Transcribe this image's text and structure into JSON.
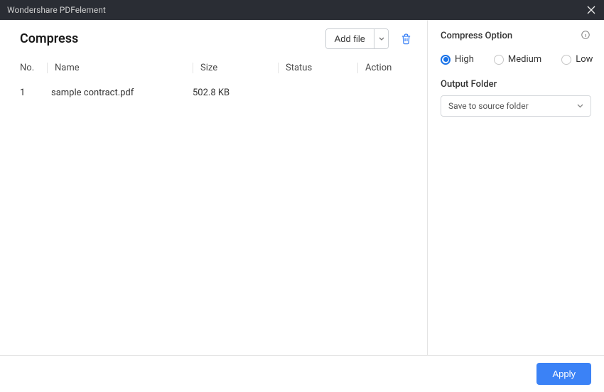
{
  "titlebar": {
    "appTitle": "Wondershare PDFelement"
  },
  "page": {
    "title": "Compress",
    "addFileLabel": "Add file"
  },
  "table": {
    "headers": {
      "no": "No.",
      "name": "Name",
      "size": "Size",
      "status": "Status",
      "action": "Action"
    },
    "rows": [
      {
        "no": "1",
        "name": "sample contract.pdf",
        "size": "502.8 KB",
        "status": "",
        "action": ""
      }
    ]
  },
  "side": {
    "title": "Compress Option",
    "options": {
      "high": "High",
      "medium": "Medium",
      "low": "Low"
    },
    "selected": "high",
    "folderLabel": "Output Folder",
    "folderValue": "Save to source folder"
  },
  "footer": {
    "apply": "Apply"
  }
}
